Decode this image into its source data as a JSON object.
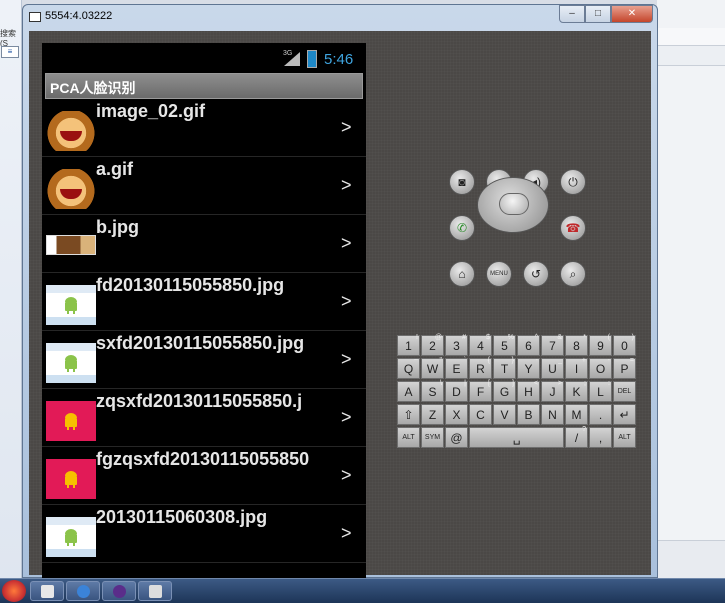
{
  "window": {
    "title": "5554:4.03222"
  },
  "desktop": {
    "left_text": "搜索(S",
    "left_field_text": "≡"
  },
  "status_bar": {
    "network": "3G",
    "time": "5:46"
  },
  "app": {
    "title": "PCA人脸识别"
  },
  "list": {
    "items": [
      {
        "title": "image_02.gif",
        "thumb": "monkey-emoji",
        "chevron": ">"
      },
      {
        "title": "a.gif",
        "thumb": "monkey-emoji",
        "chevron": ">"
      },
      {
        "title": "b.jpg",
        "thumb": "photo",
        "chevron": ">"
      },
      {
        "title": "fd20130115055850.jpg",
        "thumb": "android-blue",
        "chevron": ">"
      },
      {
        "title": "sxfd20130115055850.jpg",
        "thumb": "android-blue",
        "chevron": ">"
      },
      {
        "title": "zqsxfd20130115055850.j",
        "thumb": "android-red",
        "chevron": ">"
      },
      {
        "title": "fgzqsxfd20130115055850",
        "thumb": "android-red",
        "chevron": ">"
      },
      {
        "title": "20130115060308.jpg",
        "thumb": "android-blue",
        "chevron": ">"
      }
    ]
  },
  "controls": {
    "camera": "camera-icon",
    "vol_down": "volume-down-icon",
    "vol_up": "volume-up-icon",
    "power": "power-icon",
    "call": "call-icon",
    "end_call": "end-call-icon",
    "home": "home-icon",
    "menu": "MENU",
    "back": "back-icon",
    "search": "search-icon"
  },
  "keyboard": {
    "row1": [
      [
        "1",
        "!"
      ],
      [
        "2",
        "@"
      ],
      [
        "3",
        "#"
      ],
      [
        "4",
        "$"
      ],
      [
        "5",
        "%"
      ],
      [
        "6",
        "^"
      ],
      [
        "7",
        "&"
      ],
      [
        "8",
        "*"
      ],
      [
        "9",
        "("
      ],
      [
        "0",
        ")"
      ]
    ],
    "row2": [
      [
        "Q",
        "~"
      ],
      [
        "W",
        "\""
      ],
      [
        "E",
        "`"
      ],
      [
        "R",
        "{"
      ],
      [
        "T",
        "}"
      ],
      [
        "Y",
        "-"
      ],
      [
        "U",
        "_"
      ],
      [
        "I",
        "+"
      ],
      [
        "O",
        "-"
      ],
      [
        "P",
        "="
      ]
    ],
    "row3": [
      [
        "A",
        ""
      ],
      [
        "S",
        "\\"
      ],
      [
        "D",
        "|"
      ],
      [
        "F",
        "["
      ],
      [
        "G",
        "]"
      ],
      [
        "H",
        "<"
      ],
      [
        "J",
        ">"
      ],
      [
        "K",
        ";"
      ],
      [
        "L",
        ":"
      ],
      [
        "DEL",
        ""
      ]
    ],
    "row4": [
      [
        "⇧",
        ""
      ],
      [
        "Z",
        ""
      ],
      [
        "X",
        ""
      ],
      [
        "C",
        ""
      ],
      [
        "V",
        ""
      ],
      [
        "B",
        ""
      ],
      [
        "N",
        ""
      ],
      [
        "M",
        ""
      ],
      [
        ".",
        ""
      ],
      [
        "↵",
        ""
      ]
    ],
    "row5": [
      [
        "ALT",
        ""
      ],
      [
        "SYM",
        ""
      ],
      [
        "@",
        ""
      ],
      [
        "␣",
        ""
      ],
      [
        "/",
        "?"
      ],
      [
        ",",
        ""
      ],
      [
        "ALT",
        ""
      ]
    ]
  }
}
